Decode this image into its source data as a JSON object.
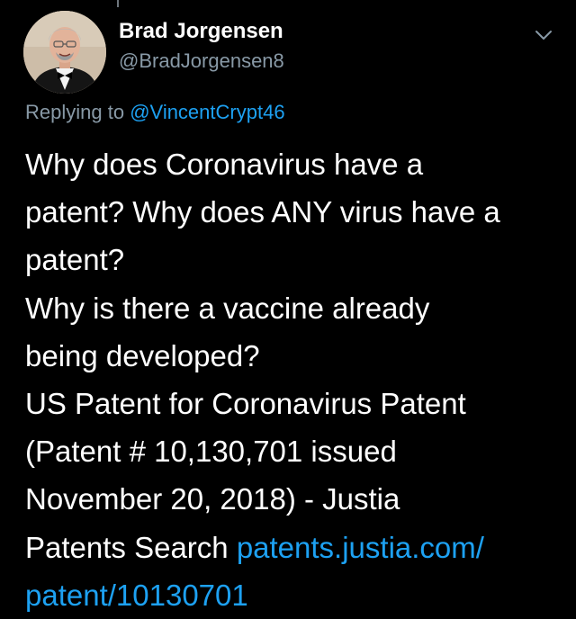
{
  "tweet": {
    "author_name": "Brad Jorgensen",
    "author_handle": "@BradJorgensen8",
    "replying_prefix": "Replying to",
    "replying_mention": "@VincentCrypt46",
    "body_lines": [
      "Why does Coronavirus have a",
      "patent? Why does ANY virus have a",
      "patent?",
      "Why is there a vaccine already",
      "being developed?",
      "US Patent for Coronavirus Patent",
      "(Patent # 10,130,701 issued",
      "November 20, 2018) - Justia"
    ],
    "last_line_text": "Patents Search ",
    "link_part1": "patents.justia.com/",
    "link_part2": "patent/10130701"
  },
  "icons": {
    "avatar": "avatar-photo",
    "caret": "chevron-down-icon"
  },
  "colors": {
    "background": "#000000",
    "primary_text": "#ffffff",
    "secondary_text": "#8899a6",
    "link": "#1da1f2"
  }
}
